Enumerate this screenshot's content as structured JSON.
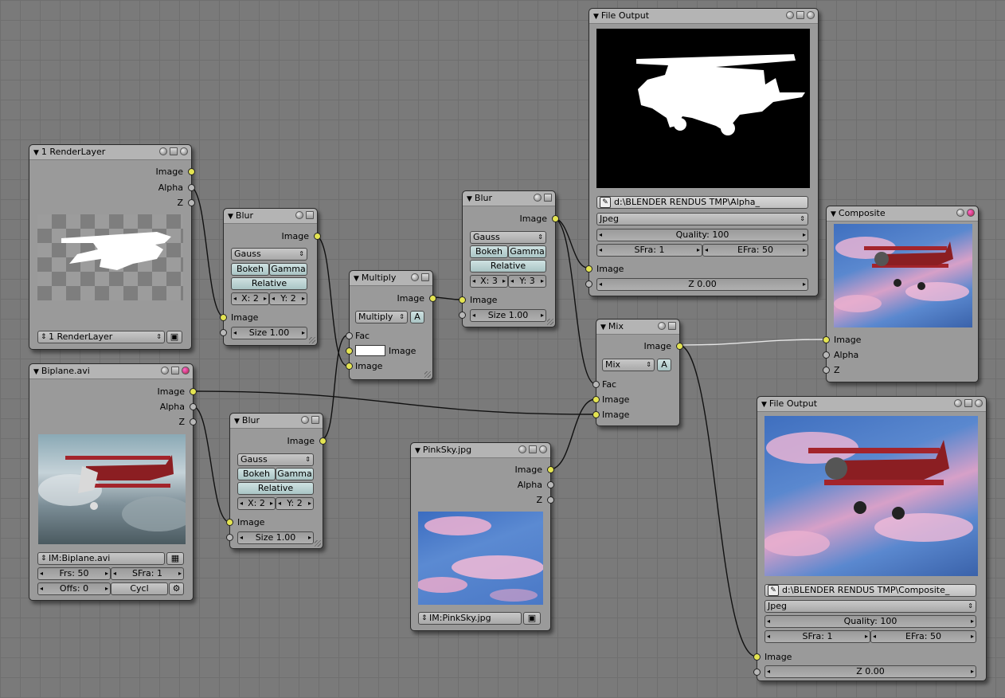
{
  "nodes": {
    "renderlayer": {
      "title": "1 RenderLayer",
      "out_image": "Image",
      "out_alpha": "Alpha",
      "out_z": "Z",
      "layer_select": "1 RenderLayer"
    },
    "blur1": {
      "title": "Blur",
      "out_image": "Image",
      "filter": "Gauss",
      "bokeh": "Bokeh",
      "gamma": "Gamma",
      "relative": "Relative",
      "x": "X: 2",
      "y": "Y: 2",
      "in_image": "Image",
      "size": "Size 1.00"
    },
    "multiply": {
      "title": "Multiply",
      "out_image": "Image",
      "blend": "Multiply",
      "alpha_toggle": "A",
      "in_fac": "Fac",
      "in_image1": "Image",
      "in_image2": "Image"
    },
    "blur2": {
      "title": "Blur",
      "out_image": "Image",
      "filter": "Gauss",
      "bokeh": "Bokeh",
      "gamma": "Gamma",
      "relative": "Relative",
      "x": "X: 3",
      "y": "Y: 3",
      "in_image": "Image",
      "size": "Size 1.00"
    },
    "fileout1": {
      "title": "File Output",
      "path": "d:\\BLENDER RENDUS TMP\\Alpha_",
      "format": "Jpeg",
      "quality": "Quality: 100",
      "sfra": "SFra: 1",
      "efra": "EFra: 50",
      "in_image": "Image",
      "z": "Z 0.00"
    },
    "composite": {
      "title": "Composite",
      "in_image": "Image",
      "in_alpha": "Alpha",
      "in_z": "Z"
    },
    "biplane": {
      "title": "Biplane.avi",
      "out_image": "Image",
      "out_alpha": "Alpha",
      "out_z": "Z",
      "image_select": "IM:Biplane.avi",
      "frs": "Frs: 50",
      "sfra": "SFra: 1",
      "offs": "Offs: 0",
      "cycl": "Cycl"
    },
    "blur3": {
      "title": "Blur",
      "out_image": "Image",
      "filter": "Gauss",
      "bokeh": "Bokeh",
      "gamma": "Gamma",
      "relative": "Relative",
      "x": "X: 2",
      "y": "Y: 2",
      "in_image": "Image",
      "size": "Size 1.00"
    },
    "mix": {
      "title": "Mix",
      "out_image": "Image",
      "blend": "Mix",
      "alpha_toggle": "A",
      "in_fac": "Fac",
      "in_image1": "Image",
      "in_image2": "Image"
    },
    "pinksky": {
      "title": "PinkSky.jpg",
      "out_image": "Image",
      "out_alpha": "Alpha",
      "out_z": "Z",
      "image_select": "IM:PinkSky.jpg"
    },
    "fileout2": {
      "title": "File Output",
      "path": "d:\\BLENDER RENDUS TMP\\Composite_",
      "format": "Jpeg",
      "quality": "Quality: 100",
      "sfra": "SFra: 1",
      "efra": "EFra: 50",
      "in_image": "Image",
      "z": "Z 0.00"
    }
  },
  "colors": {
    "socket_image": "#e4e452",
    "socket_value": "#b8b8b8",
    "node_body": "#9a9a9a",
    "node_header": "#b4b4b4",
    "toggle_cyan": "#bcd4d4"
  }
}
